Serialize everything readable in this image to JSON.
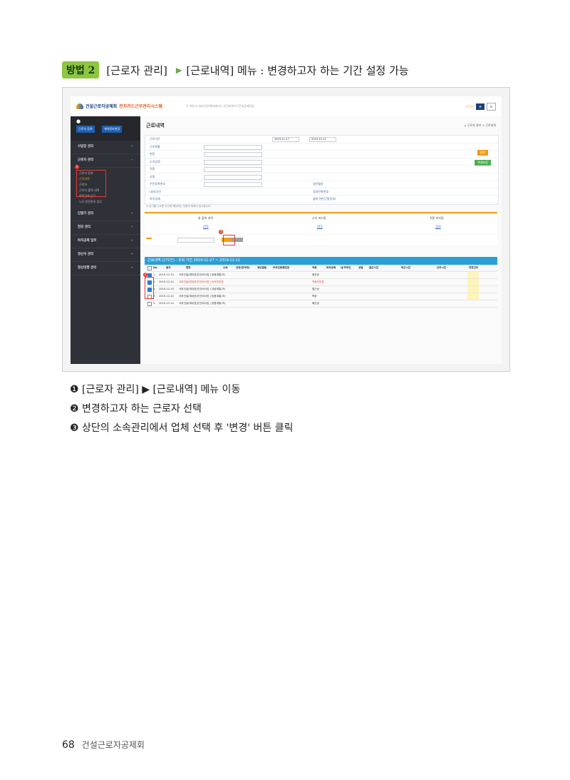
{
  "heading": {
    "badge": "방법 2",
    "part1": "[근로자 관리]",
    "arrow": "▶",
    "part2": "[근로내역] 메뉴 : 변경하고자 하는 기간 설정 가능"
  },
  "screenshot": {
    "logo_text": "건설근로자공제회",
    "logo_sub": "전자카드근무관리시스템",
    "top_notice": "두 재도리 세부인원체(대표자:) 인건비관리 (건설공제1팀)",
    "page_title": "근로내역",
    "breadcrumb": "근로자 관리 > 근로내역",
    "sidebar": {
      "buttons": [
        "근로자 등록",
        "계약정보변경"
      ],
      "menus": [
        {
          "label": "사업장 관리",
          "mark": "+"
        },
        {
          "label": "근로자 관리",
          "mark": "−"
        },
        {
          "label": "단말기 관리",
          "mark": "+"
        },
        {
          "label": "현장 관리",
          "mark": "+"
        },
        {
          "label": "퇴직공제 업무",
          "mark": "+"
        },
        {
          "label": "정산서 관리",
          "mark": "+"
        },
        {
          "label": "청산대행 관리",
          "mark": "+"
        }
      ],
      "submenu": [
        "근로자 등록",
        "근로내역",
        "근로자",
        "근로자 출역 내역",
        "퇴직공제 업무",
        "노무·안전관리 업무"
      ]
    },
    "form_labels": [
      "근로기간",
      "근로현황",
      "현장",
      "소속업체",
      "직종",
      "성명",
      "주민등록번호",
      "내/외국인",
      "특이공제"
    ],
    "form_right_labels": [
      "생년월일",
      "휴대전화번호",
      "출퇴구분(단말정보)"
    ],
    "date_from": "2019-11-27",
    "date_to": "2019-12-11",
    "search_btn": "검색",
    "excel_btn": "엑셀저장",
    "notice_line": "※ 상기를 누르면 조건에 해당하는 인원의 목록이 표시됩니다.",
    "stats": {
      "cols": [
        "총 출역 내역",
        "소속 미지정",
        "직종 미지정"
      ],
      "vals": [
        "272",
        "111",
        "114"
      ]
    },
    "grid_title": "근로내역 (272건) - 조회 기간 2019-11-27 ~ 2019-12-11",
    "grid_headers": [
      "No.",
      "일자",
      "현장",
      "소속",
      "성명(한국명)",
      "생년월일",
      "외국인등록번호",
      "직종",
      "퇴직공제",
      "내/외국인",
      "성별",
      "출근시간",
      "퇴근시간",
      "근무시간",
      "연장근무"
    ],
    "rows": [
      {
        "no": "1",
        "date": "2019-12-10",
        "site": "서부건설(재대표)인건비사업 | 등용계통(조)",
        "job": "배관공",
        "checked": true
      },
      {
        "no": "2",
        "date": "2019-12-10",
        "site": "서부건설(재대표)인건비사업 | 소속미지정",
        "job": "직종미지정",
        "checked": true
      },
      {
        "no": "3",
        "date": "2019-12-10",
        "site": "서부건설(재대표)인건비사업 | 유림계통(조)",
        "job": "철근공",
        "checked": true
      },
      {
        "no": "4",
        "date": "2019-12-10",
        "site": "서부건설(재대표)인건비사업 | 등용계통(조)",
        "job": "목공",
        "checked": false
      },
      {
        "no": "5",
        "date": "2019-12-10",
        "site": "서부건설(재대표)인건비사업 | 등용계통(조)",
        "job": "배관공",
        "checked": false
      }
    ],
    "markers": [
      "1",
      "2",
      "3"
    ]
  },
  "captions": [
    {
      "num": "❶",
      "text": "[근로자 관리] ▶ [근로내역] 메뉴 이동"
    },
    {
      "num": "❷",
      "text": "변경하고자 하는 근로자 선택"
    },
    {
      "num": "❸",
      "text": "상단의 소속관리에서 업체 선택 후 '변경' 버튼 클릭"
    }
  ],
  "footer": {
    "page_number": "68",
    "publisher": "건설근로자공제회"
  },
  "colors": {
    "badge": "#8dc63f",
    "grid_header": "#2a9fd6",
    "orange": "#f39b1a",
    "marker_red": "#e53935",
    "sidebar": "#2f3138"
  }
}
